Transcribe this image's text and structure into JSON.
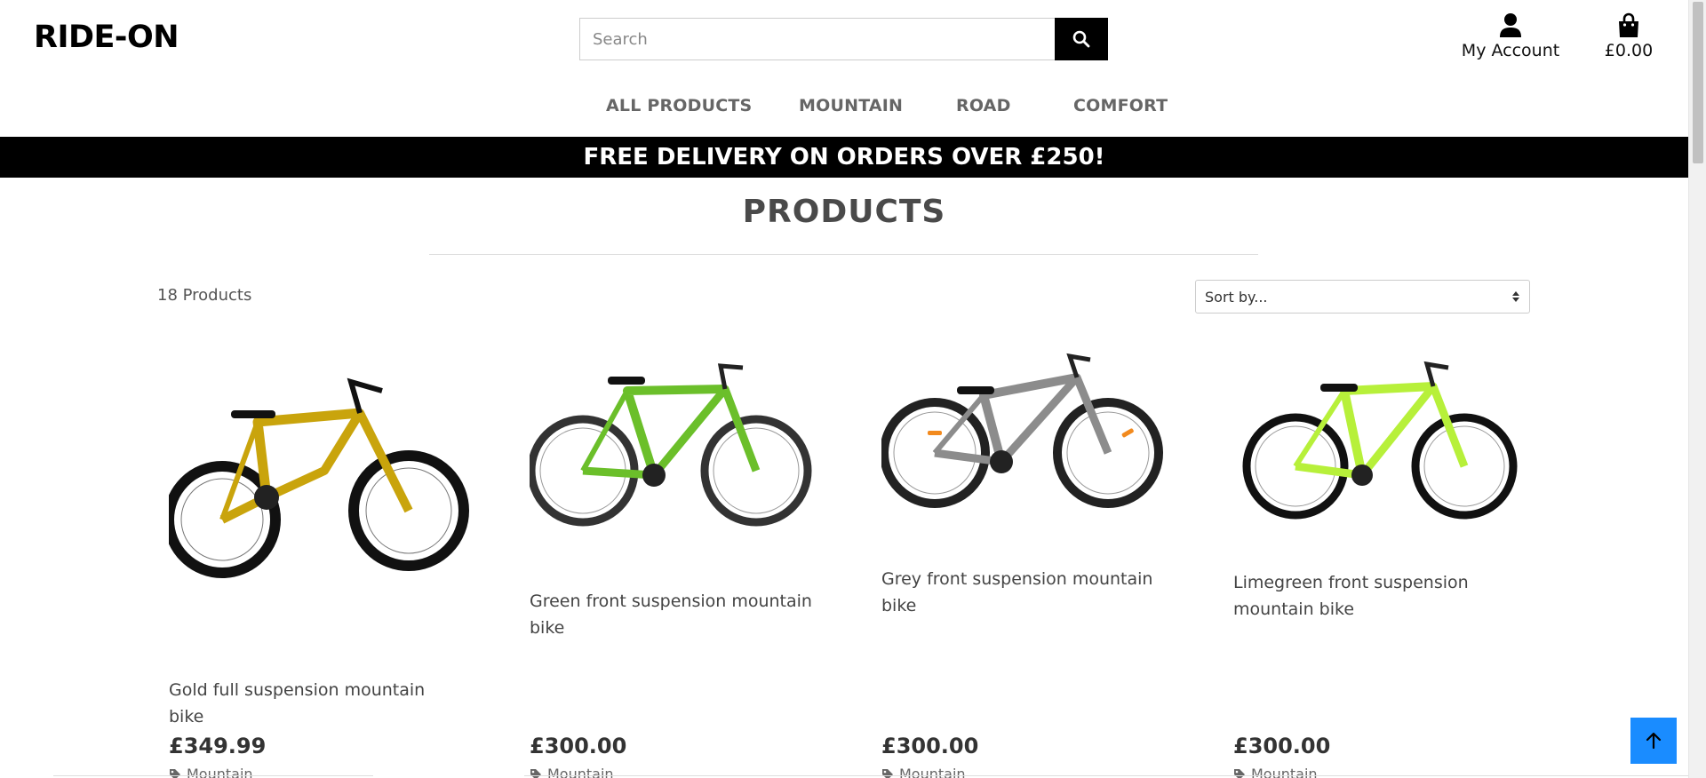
{
  "brand": "RIDE-ON",
  "search": {
    "placeholder": "Search"
  },
  "account": {
    "label": "My Account"
  },
  "cart": {
    "total": "£0.00"
  },
  "nav": [
    "ALL PRODUCTS",
    "MOUNTAIN",
    "ROAD",
    "COMFORT"
  ],
  "banner": "FREE DELIVERY ON ORDERS OVER £250!",
  "page_title": "PRODUCTS",
  "product_count": "18 Products",
  "sort": {
    "selected": "Sort by..."
  },
  "products": [
    {
      "name": "Gold full suspension mountain bike",
      "price": "£349.99",
      "frame_color": "#c9a40c",
      "category": "Mountain"
    },
    {
      "name": "Green front suspension mountain bike",
      "price": "£300.00",
      "frame_color": "#6bbf2a",
      "category": "Mountain"
    },
    {
      "name": "Grey front suspension mountain bike",
      "price": "£300.00",
      "frame_color": "#8c8c8c",
      "category": "Mountain"
    },
    {
      "name": "Limegreen front suspension mountain bike",
      "price": "£300.00",
      "frame_color": "#b7f03a",
      "category": "Mountain"
    }
  ],
  "icons": {
    "search": "search-icon",
    "account": "user-icon",
    "cart": "shopping-bag-icon",
    "category": "tag-icon",
    "back_to_top": "arrow-up-icon"
  },
  "colors": {
    "banner": "#000000",
    "back_to_top": "#1a8cff",
    "nav_text": "#666666"
  }
}
